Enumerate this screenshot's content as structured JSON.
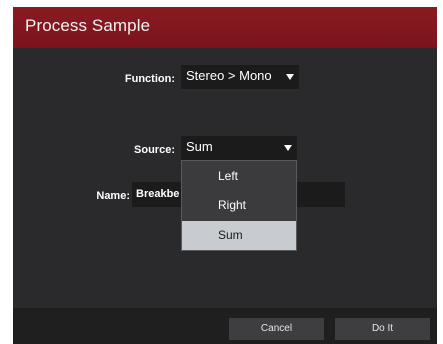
{
  "dialog": {
    "title": "Process Sample"
  },
  "function_field": {
    "label": "Function:",
    "value": "Stereo > Mono"
  },
  "source_field": {
    "label": "Source:",
    "value": "Sum",
    "options": [
      "Left",
      "Right",
      "Sum"
    ],
    "selected": "Sum"
  },
  "name_field": {
    "label": "Name:",
    "value": "Breakbe"
  },
  "footer": {
    "cancel_label": "Cancel",
    "doit_label": "Do It"
  },
  "colors": {
    "title_bar": "#7a141c",
    "panel": "#2a2a2c",
    "field": "#1b1b1c",
    "selected_option": "#c8cbd0"
  }
}
